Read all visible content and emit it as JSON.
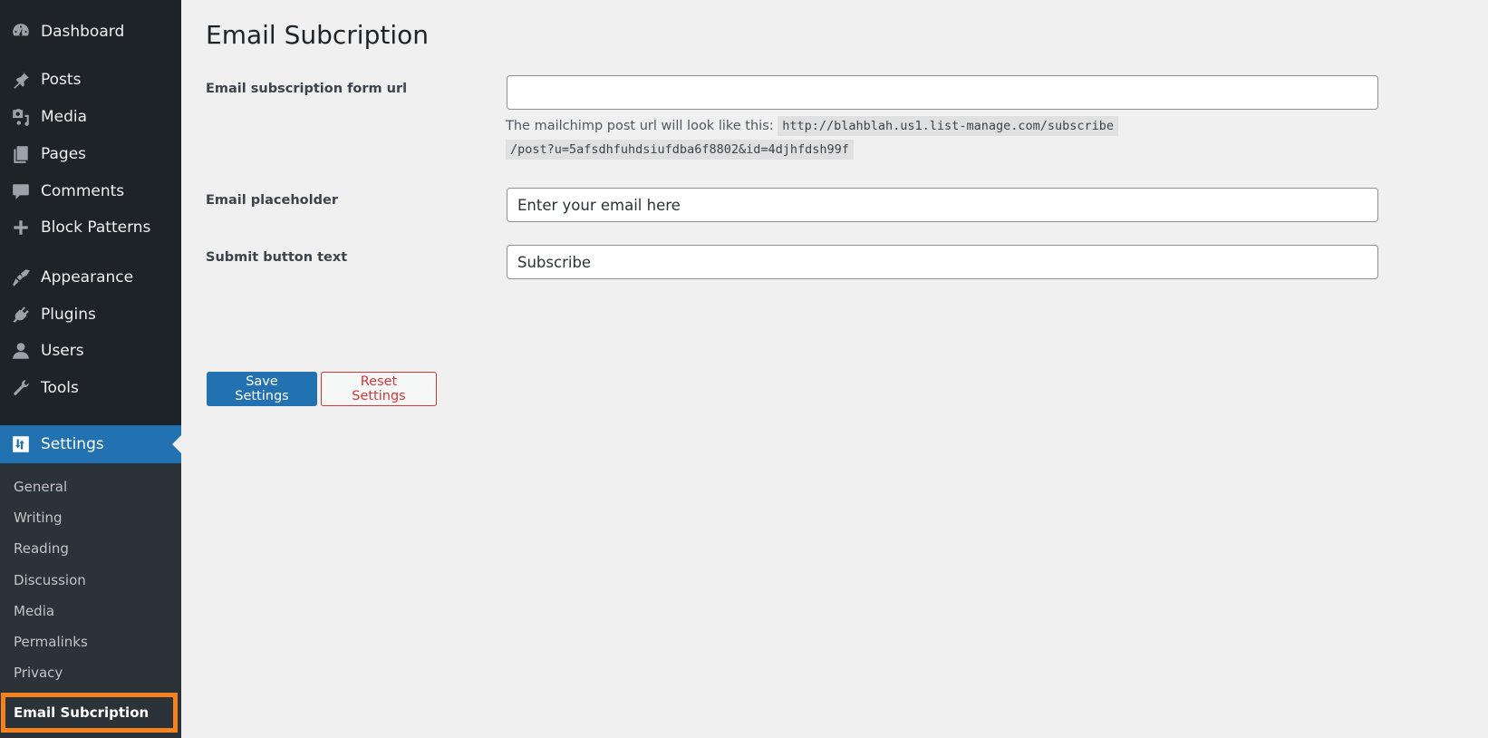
{
  "sidebar": {
    "items": [
      {
        "label": "Dashboard",
        "icon": "dashboard-icon"
      },
      {
        "label": "Posts",
        "icon": "pin-icon"
      },
      {
        "label": "Media",
        "icon": "media-icon"
      },
      {
        "label": "Pages",
        "icon": "pages-icon"
      },
      {
        "label": "Comments",
        "icon": "comment-icon"
      },
      {
        "label": "Block Patterns",
        "icon": "plus-icon"
      },
      {
        "label": "Appearance",
        "icon": "paintbrush-icon"
      },
      {
        "label": "Plugins",
        "icon": "plug-icon"
      },
      {
        "label": "Users",
        "icon": "user-icon"
      },
      {
        "label": "Tools",
        "icon": "wrench-icon"
      },
      {
        "label": "Settings",
        "icon": "settings-sliders-icon",
        "active": true
      }
    ],
    "submenu": [
      {
        "label": "General"
      },
      {
        "label": "Writing"
      },
      {
        "label": "Reading"
      },
      {
        "label": "Discussion"
      },
      {
        "label": "Media"
      },
      {
        "label": "Permalinks"
      },
      {
        "label": "Privacy"
      },
      {
        "label": "Email Subcription",
        "current": true
      }
    ],
    "highlight_color": "#f6821f",
    "active_color": "#2271b1"
  },
  "page": {
    "title": "Email Subcription",
    "fields": [
      {
        "label": "Email subscription form url",
        "value": "",
        "description_text": "The mailchimp post url will look like this:",
        "description_code_line1": "http://blahblah.us1.list-manage.com/subscribe",
        "description_code_line2": "/post?u=5afsdhfuhdsiufdba6f8802&id=4djhfdsh99f"
      },
      {
        "label": "Email placeholder",
        "value": "Enter your email here"
      },
      {
        "label": "Submit button text",
        "value": "Subscribe"
      }
    ],
    "buttons": {
      "save": "Save Settings",
      "reset": "Reset Settings"
    }
  }
}
